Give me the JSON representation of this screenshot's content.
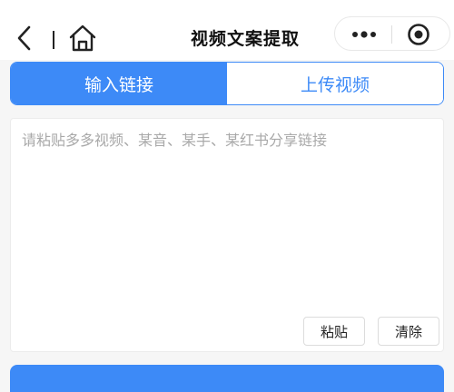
{
  "header": {
    "title": "视频文案提取",
    "icons": [
      "chevron-left-icon",
      "home-icon",
      "more-icon",
      "target-icon"
    ]
  },
  "tabs": [
    {
      "label": "输入链接",
      "active": true
    },
    {
      "label": "上传视频",
      "active": false
    }
  ],
  "input": {
    "placeholder": "请粘贴多多视频、某音、某手、某红书分享链接",
    "value": ""
  },
  "buttons": {
    "paste_label": "粘贴",
    "clear_label": "清除"
  },
  "colors": {
    "accent": "#3d8af7",
    "background": "#f6f6f6",
    "placeholder": "#a9a9a9"
  }
}
